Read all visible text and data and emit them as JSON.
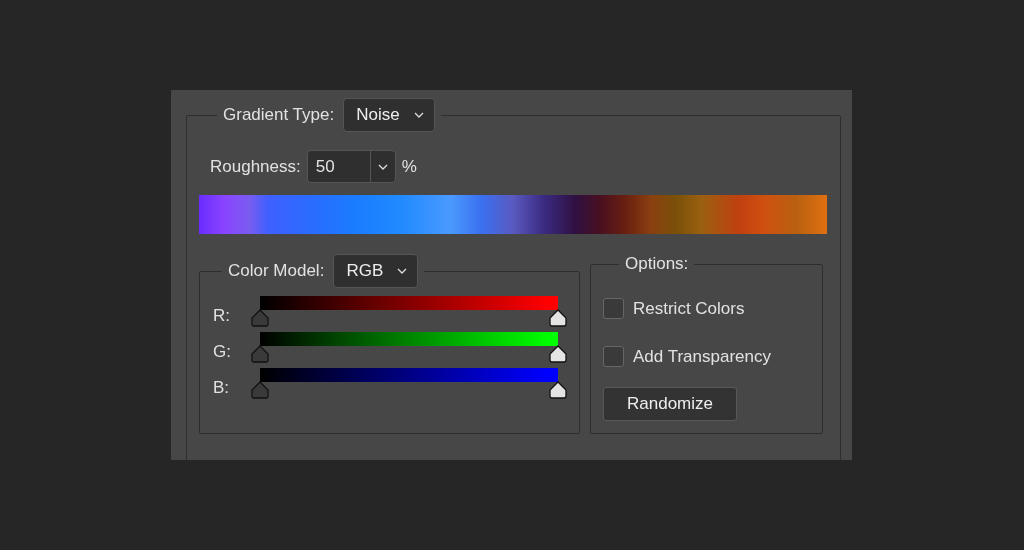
{
  "gradient_type": {
    "label": "Gradient Type:",
    "value": "Noise"
  },
  "roughness": {
    "label": "Roughness:",
    "value": "50",
    "unit": "%"
  },
  "color_model": {
    "label": "Color Model:",
    "value": "RGB",
    "channels": [
      {
        "label": "R:",
        "color": "#ff0000",
        "low": {
          "level": 0
        },
        "high": {
          "level": 1
        }
      },
      {
        "label": "G:",
        "color": "#00ff00",
        "low": {
          "level": 0
        },
        "high": {
          "level": 1
        }
      },
      {
        "label": "B:",
        "color": "#0000ff",
        "low": {
          "level": 0
        },
        "high": {
          "level": 1
        }
      }
    ]
  },
  "options": {
    "title": "Options:",
    "checkboxes": [
      {
        "label": "Restrict Colors",
        "checked": false
      },
      {
        "label": "Add Transparency",
        "checked": false
      }
    ],
    "button": "Randomize"
  }
}
